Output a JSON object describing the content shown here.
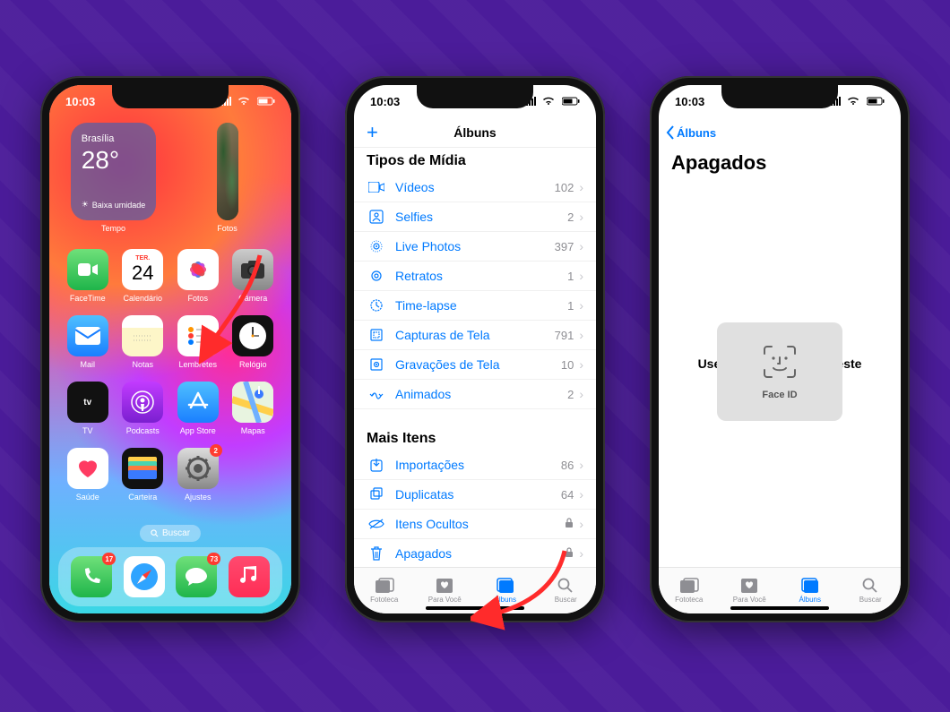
{
  "status": {
    "time": "10:03"
  },
  "home": {
    "weather": {
      "city": "Brasília",
      "temp": "28°",
      "cond_icon": "☀",
      "cond": "Baixa umidade",
      "widget_label": "Tempo"
    },
    "photos_widget_label": "Fotos",
    "apps_row1": [
      {
        "key": "facetime",
        "label": "FaceTime"
      },
      {
        "key": "cal",
        "label": "Calendário",
        "cal_day": "TER.",
        "cal_num": "24"
      },
      {
        "key": "photos",
        "label": "Fotos"
      },
      {
        "key": "camera",
        "label": "Câmera"
      }
    ],
    "apps_row2": [
      {
        "key": "mail",
        "label": "Mail"
      },
      {
        "key": "notes",
        "label": "Notas"
      },
      {
        "key": "remind",
        "label": "Lembretes"
      },
      {
        "key": "clock",
        "label": "Relógio"
      }
    ],
    "apps_row3": [
      {
        "key": "tv",
        "label": "TV"
      },
      {
        "key": "podcast",
        "label": "Podcasts"
      },
      {
        "key": "appstore",
        "label": "App Store"
      },
      {
        "key": "maps",
        "label": "Mapas"
      }
    ],
    "apps_row4": [
      {
        "key": "health",
        "label": "Saúde"
      },
      {
        "key": "wallet",
        "label": "Carteira"
      },
      {
        "key": "settings",
        "label": "Ajustes",
        "badge": "2"
      }
    ],
    "search_label": "Buscar",
    "dock": [
      {
        "key": "phone",
        "badge": "17"
      },
      {
        "key": "safari"
      },
      {
        "key": "msg",
        "badge": "73"
      },
      {
        "key": "music"
      }
    ]
  },
  "albums": {
    "nav_title": "Álbuns",
    "section_media": "Tipos de Mídia",
    "media_rows": [
      {
        "icon": "video",
        "label": "Vídeos",
        "count": "102"
      },
      {
        "icon": "selfie",
        "label": "Selfies",
        "count": "2"
      },
      {
        "icon": "live",
        "label": "Live Photos",
        "count": "397"
      },
      {
        "icon": "portrait",
        "label": "Retratos",
        "count": "1"
      },
      {
        "icon": "timelapse",
        "label": "Time-lapse",
        "count": "1"
      },
      {
        "icon": "screenshot",
        "label": "Capturas de Tela",
        "count": "791"
      },
      {
        "icon": "screenrec",
        "label": "Gravações de Tela",
        "count": "10"
      },
      {
        "icon": "animated",
        "label": "Animados",
        "count": "2"
      }
    ],
    "section_other": "Mais Itens",
    "other_rows": [
      {
        "icon": "import",
        "label": "Importações",
        "count": "86"
      },
      {
        "icon": "dup",
        "label": "Duplicatas",
        "count": "64"
      },
      {
        "icon": "hidden",
        "label": "Itens Ocultos",
        "locked": true
      },
      {
        "icon": "trash",
        "label": "Apagados",
        "locked": true
      }
    ],
    "tabs": [
      {
        "label": "Fototeca"
      },
      {
        "label": "Para Você"
      },
      {
        "label": "Álbuns",
        "active": true
      },
      {
        "label": "Buscar"
      }
    ]
  },
  "deleted": {
    "back_label": "Álbuns",
    "title": "Apagados",
    "faceid_msg": "Use o Face ID para Ver este Álbum",
    "faceid_label": "Face ID"
  }
}
